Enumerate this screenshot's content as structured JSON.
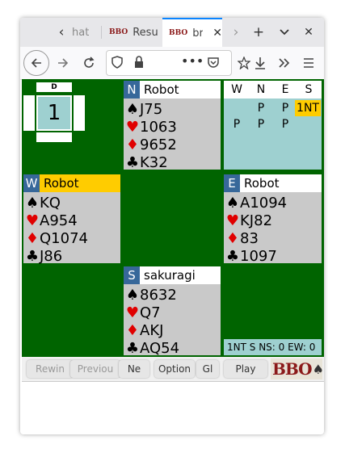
{
  "browser": {
    "tabs": [
      {
        "title": "hat",
        "favicon": ""
      },
      {
        "title": "Resu",
        "favicon": "BBO"
      },
      {
        "title": "br",
        "favicon": "BBO"
      }
    ],
    "close_glyph": "✕",
    "new_tab_glyph": "+",
    "list_tabs_glyph": "⌄",
    "window_close_glyph": "✕"
  },
  "board": {
    "dealer_label": "D",
    "number": "1"
  },
  "hands": {
    "north": {
      "dir": "N",
      "name": "Robot",
      "spades": "J75",
      "hearts": "1063",
      "diamonds": "9652",
      "clubs": "K32"
    },
    "west": {
      "dir": "W",
      "name": "Robot",
      "spades": "KQ",
      "hearts": "A954",
      "diamonds": "Q1074",
      "clubs": "J86"
    },
    "east": {
      "dir": "E",
      "name": "Robot",
      "spades": "A1094",
      "hearts": "KJ82",
      "diamonds": "83",
      "clubs": "1097"
    },
    "south": {
      "dir": "S",
      "name": "sakuragi",
      "spades": "8632",
      "hearts": "Q7",
      "diamonds": "AKJ",
      "clubs": "AQ54"
    }
  },
  "suits": {
    "spades": "♠",
    "hearts": "♥",
    "diamonds": "♦",
    "clubs": "♣"
  },
  "auction": {
    "headers": [
      "W",
      "N",
      "E",
      "S"
    ],
    "row1": [
      "",
      "P",
      "P",
      "1NT"
    ],
    "row2": [
      "P",
      "P",
      "P",
      ""
    ]
  },
  "status": "1NT S  NS: 0 EW: 0",
  "toolbar": {
    "rewind": "Rewin",
    "previous": "Previou",
    "next": "Ne",
    "options": "Option",
    "gib": "Gl",
    "play": "Play",
    "logo": "BBO"
  },
  "colors": {
    "felt": "#006400",
    "highlight": "#ffcc00",
    "auction_bg": "#9ed0d0",
    "dir_badge": "#37689a"
  }
}
